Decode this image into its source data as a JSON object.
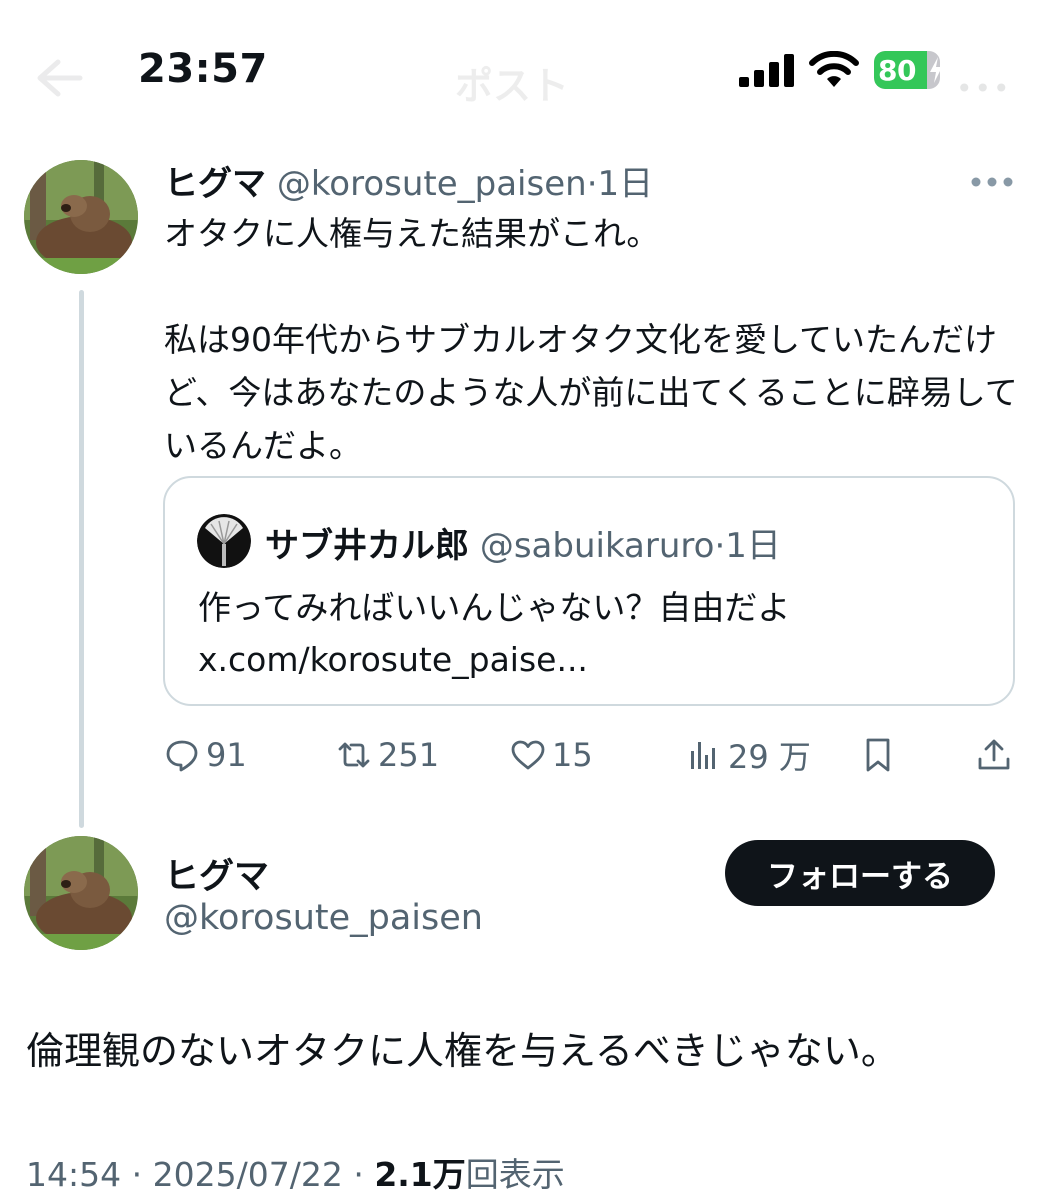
{
  "status_bar": {
    "time": "23:57",
    "battery_percent": "80",
    "battery_level": 0.8
  },
  "nav": {
    "title": "ポスト"
  },
  "tweet": {
    "author_name": "ヒグマ",
    "author_handle": "@korosute_paisen",
    "age": "1日",
    "text": "オタクに人権与えた結果がこれ。\n\n私は90年代からサブカルオタク文化を愛していたんだけど、今はあなたのような人が前に出てくることに辟易しているんだよ。",
    "quote": {
      "author_name": "サブ井カル郎",
      "author_handle": "@sabuikaruro",
      "age": "1日",
      "text": "作ってみればいいんじゃない？自由だよ x.com/korosute_paise..."
    },
    "actions": {
      "replies": "91",
      "reposts": "251",
      "likes": "15",
      "views": "29 万"
    }
  },
  "reply": {
    "author_name": "ヒグマ",
    "author_handle": "@korosute_paisen",
    "follow_label": "フォローする",
    "text": "倫理観のないオタクに人権を与えるべきじゃない。",
    "time": "14:54",
    "date": "2025/07/22",
    "views_count": "2.1万",
    "views_suffix": "回表示"
  },
  "colors": {
    "text": "#0f1419",
    "secondary": "#536471",
    "border": "#cfd9de",
    "battery": "#34c759"
  }
}
